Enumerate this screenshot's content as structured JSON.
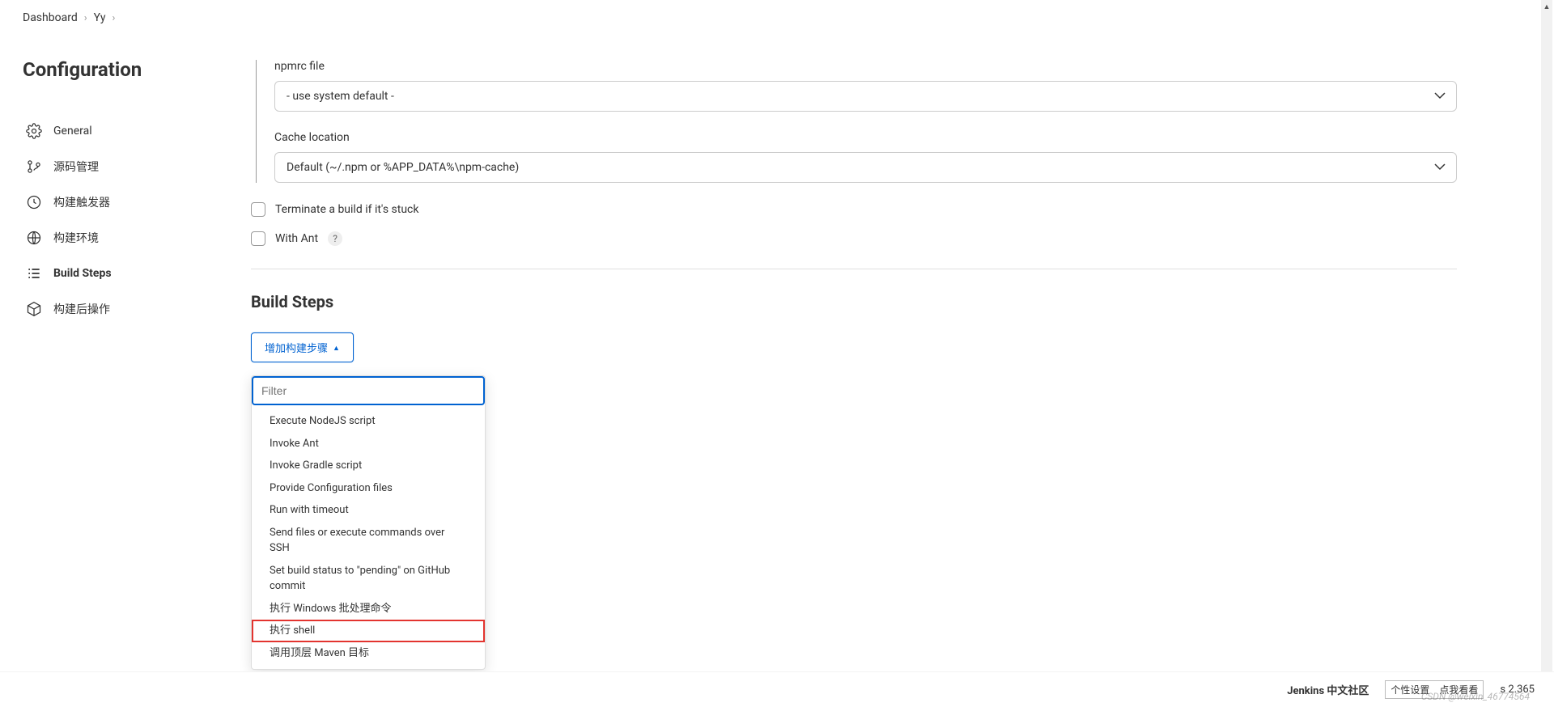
{
  "breadcrumb": {
    "items": [
      "Dashboard",
      "Yy"
    ]
  },
  "sidebar": {
    "title": "Configuration",
    "items": [
      {
        "label": "General"
      },
      {
        "label": "源码管理"
      },
      {
        "label": "构建触发器"
      },
      {
        "label": "构建环境"
      },
      {
        "label": "Build Steps"
      },
      {
        "label": "构建后操作"
      }
    ]
  },
  "content": {
    "npmrc_label": "npmrc file",
    "npmrc_value": "- use system default -",
    "cache_label": "Cache location",
    "cache_value": "Default (~/.npm or %APP_DATA%\\npm-cache)",
    "terminate_label": "Terminate a build if it's stuck",
    "withant_label": "With Ant",
    "help_text": "?",
    "build_steps_title": "Build Steps",
    "add_step_label": "增加构建步骤"
  },
  "dropdown": {
    "filter_placeholder": "Filter",
    "items": [
      "Execute NodeJS script",
      "Invoke Ant",
      "Invoke Gradle script",
      "Provide Configuration files",
      "Run with timeout",
      "Send files or execute commands over SSH",
      "Set build status to \"pending\" on GitHub commit",
      "执行 Windows 批处理命令",
      "执行 shell",
      "调用顶层 Maven 目标"
    ]
  },
  "footer": {
    "community": "Jenkins 中文社区",
    "version_suffix": "s 2.365",
    "tooltip1": "个性设置",
    "tooltip2": "点我看看"
  },
  "watermark": "CSDN @weixin_46774564"
}
